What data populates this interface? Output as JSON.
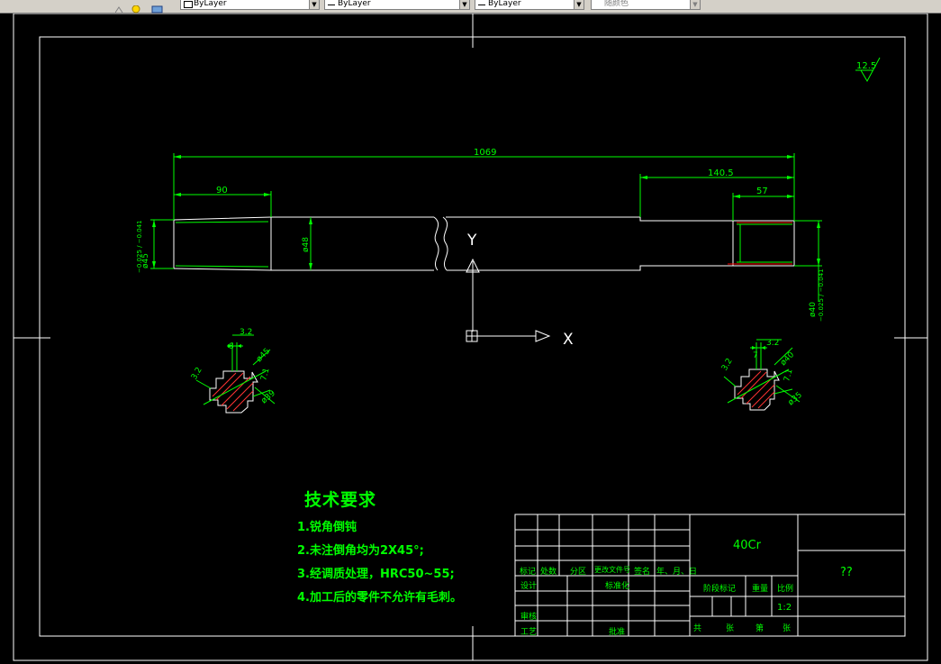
{
  "toolbar": {
    "layer_combos": [
      "ByLayer",
      "ByLayer",
      "ByLayer"
    ],
    "plot_style": "随颜色"
  },
  "drawing": {
    "roughness": "12.5",
    "dims": {
      "overall": "1069",
      "left_step": "90",
      "right_step": "140.5",
      "right_end": "57",
      "dia_left": "ø45",
      "dia_left_tol": "−0.025 / −0.041",
      "dia_mid": "ø48",
      "dia_right": "ø40",
      "dia_right_tol": "−0.025 / −0.041"
    },
    "ucs": {
      "y": "Y",
      "x": "X"
    },
    "section_left": {
      "width": "8",
      "chamfer": "3.2",
      "outer": "ø45",
      "inner": "ø39",
      "depth": "3.2",
      "r": "7.1"
    },
    "section_right": {
      "width": "7",
      "chamfer": "3.2",
      "outer": "ø40",
      "inner": "ø35",
      "depth": "3.2",
      "r": "7.1"
    }
  },
  "notes": {
    "title": "技术要求",
    "items": [
      "1.锐角倒钝",
      "2.未注倒角均为2X45°;",
      "3.经调质处理，HRC50~55;",
      "4.加工后的零件不允许有毛刺。"
    ]
  },
  "title_block": {
    "material": "40Cr",
    "part_name": "??",
    "headers": [
      "标记",
      "处数",
      "分区",
      "更改文件号",
      "签名",
      "年、月、日"
    ],
    "design": "设计",
    "standard": "标准化",
    "review": "审核",
    "process": "工艺",
    "approve": "批准",
    "stage": "阶段标记",
    "weight": "重量",
    "scale_label": "比例",
    "scale": "1:2",
    "sheets": [
      "共",
      "张",
      "第",
      "张"
    ]
  }
}
